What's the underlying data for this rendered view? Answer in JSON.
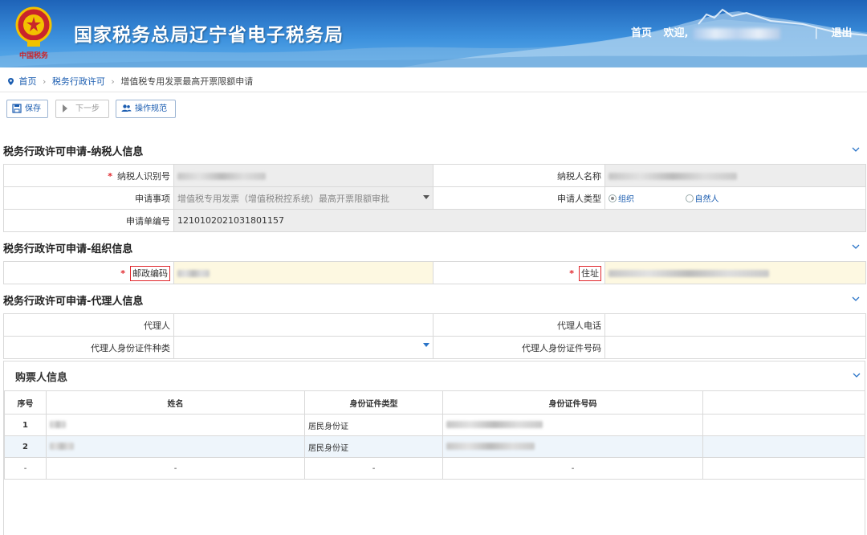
{
  "header": {
    "site_title": "国家税务总局辽宁省电子税务局",
    "emblem_text": "中国税务",
    "nav_home": "首页",
    "nav_welcome": "欢迎,",
    "nav_sep": "|",
    "nav_logout": "退出"
  },
  "breadcrumb": {
    "home": "首页",
    "level1": "税务行政许可",
    "current": "增值税专用发票最高开票限额申请"
  },
  "toolbar": {
    "save": "保存",
    "next": "下一步",
    "guide": "操作规范"
  },
  "taxpayer": {
    "title": "税务行政许可申请-纳税人信息",
    "taxpayer_id_label": "纳税人识别号",
    "taxpayer_name_label": "纳税人名称",
    "matter_label": "申请事项",
    "matter_value": "增值税专用发票（增值税税控系统）最高开票限额审批",
    "applicant_type_label": "申请人类型",
    "applicant_org": "组织",
    "applicant_person": "自然人",
    "order_no_label": "申请单编号",
    "order_no_value": "1210102021031801157"
  },
  "org": {
    "title": "税务行政许可申请-组织信息",
    "postcode_label": "邮政编码",
    "address_label": "住址"
  },
  "agent": {
    "title": "税务行政许可申请-代理人信息",
    "agent_label": "代理人",
    "agent_phone_label": "代理人电话",
    "id_type_label": "代理人身份证件种类",
    "id_no_label": "代理人身份证件号码"
  },
  "buyers": {
    "title": "购票人信息",
    "columns": [
      "序号",
      "姓名",
      "身份证件类型",
      "身份证件号码"
    ],
    "rows": [
      {
        "index": "1",
        "id_type": "居民身份证"
      },
      {
        "index": "2",
        "id_type": "居民身份证"
      },
      {
        "index": "-",
        "name": "-",
        "id_type": "-",
        "id_no": "-"
      }
    ]
  },
  "colors": {
    "header_blue": "#1e63b8",
    "link_blue": "#1a5cb0",
    "required_red": "#e0262b",
    "readonly_gray": "#ededed",
    "highlight_yellow": "#fdf8e1"
  }
}
